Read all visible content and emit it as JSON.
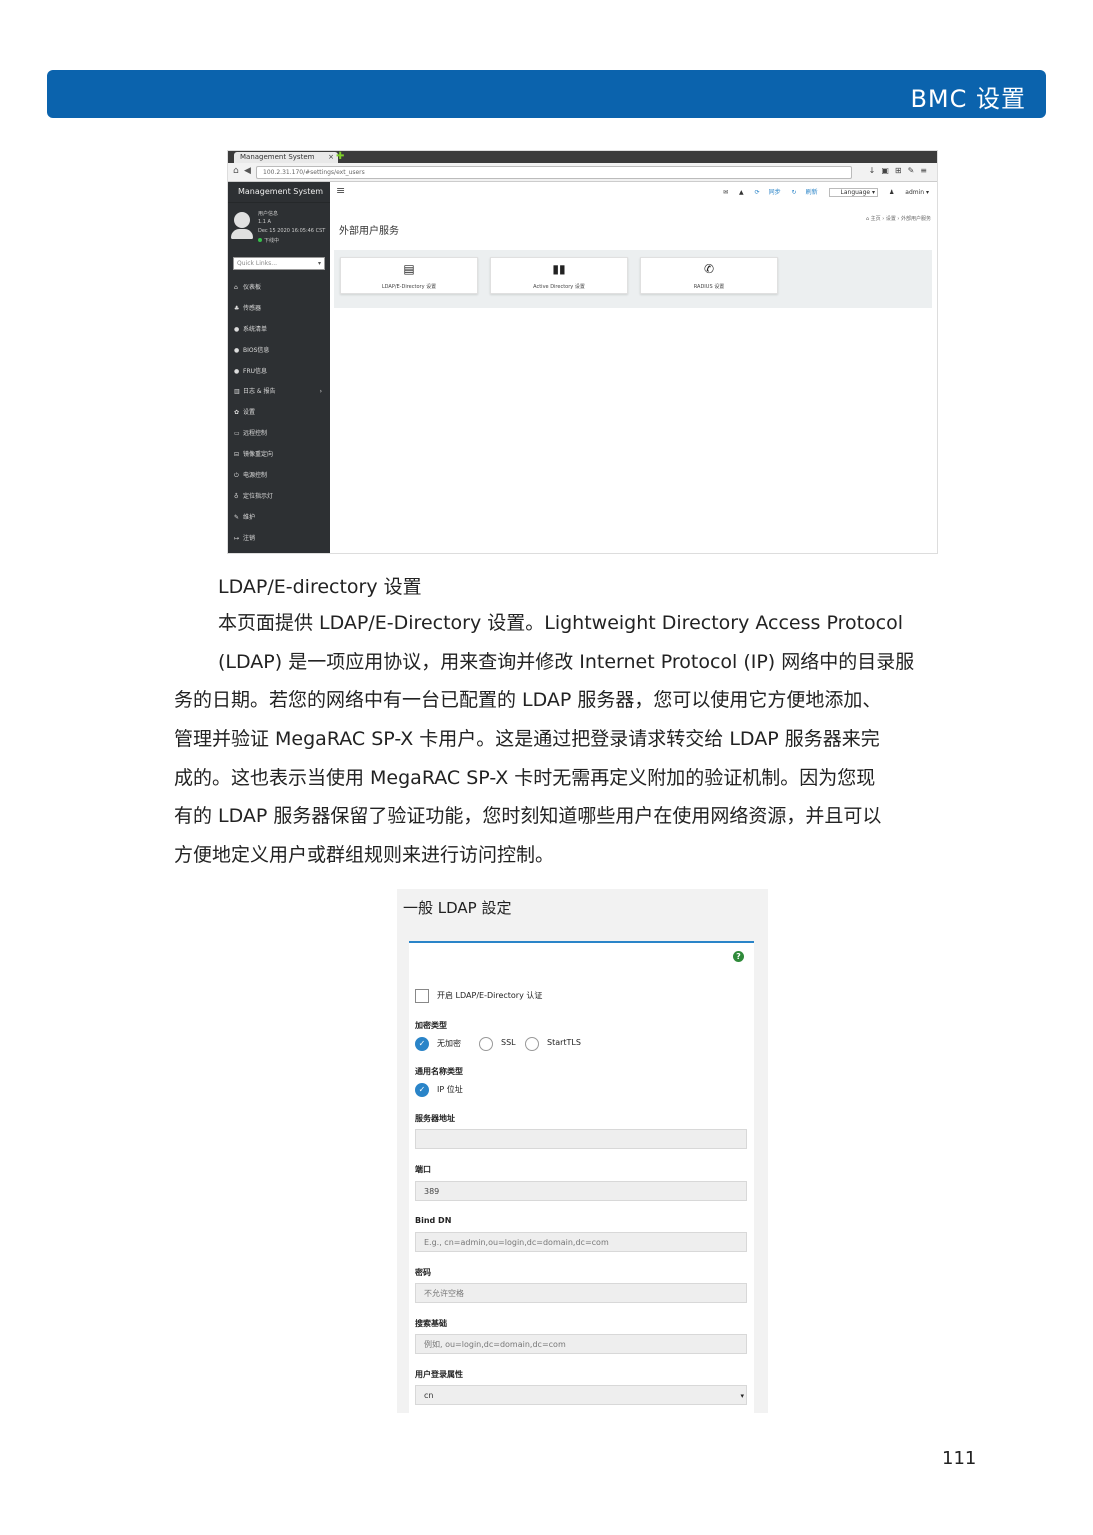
{
  "header": {
    "title": "BMC 设置"
  },
  "shot1": {
    "browser_tab": "Management System",
    "tab_close": "×",
    "url": "100.2.31.170/#settings/ext_users",
    "sidebar": {
      "brand": "Management System",
      "user_lines": [
        "用户信息",
        "1.1 A",
        "Dec 15 2020 16:05:46 CST",
        "下线中"
      ],
      "quick_links": "Quick Links...",
      "items": [
        {
          "icon": "⌂",
          "label": "仪表板"
        },
        {
          "icon": "♣",
          "label": "传感器"
        },
        {
          "icon": "●",
          "label": "系统清单"
        },
        {
          "icon": "●",
          "label": "BIOS信息"
        },
        {
          "icon": "●",
          "label": "FRU信息"
        },
        {
          "icon": "▥",
          "label": "日志 & 报告",
          "arrow": "›"
        },
        {
          "icon": "✿",
          "label": "设置"
        },
        {
          "icon": "▭",
          "label": "远程控制"
        },
        {
          "icon": "⊟",
          "label": "镜像重定向"
        },
        {
          "icon": "⏻",
          "label": "电源控制"
        },
        {
          "icon": "♁",
          "label": "定位指示灯"
        },
        {
          "icon": "✎",
          "label": "维护"
        },
        {
          "icon": "↦",
          "label": "注销"
        }
      ]
    },
    "topnav": {
      "sync": "同步",
      "refresh": "刷新",
      "language": "Language",
      "user": "admin"
    },
    "page_title": "外部用户服务",
    "breadcrumb": "⌂ 主页 › 设置 › 外部用户服务",
    "cards": [
      {
        "icon": "▤",
        "label": "LDAP/E-Directory 设置"
      },
      {
        "icon": "▮▮",
        "label": "Active Directory 设置"
      },
      {
        "icon": "✆",
        "label": "RADIUS 设置"
      }
    ]
  },
  "caption": "LDAP/E-directory 设置",
  "paragraph": [
    "本页面提供 LDAP/E-Directory 设置。Lightweight Directory Access Protocol",
    "(LDAP) 是一项应用协议，用来查询并修改 Internet Protocol (IP) 网络中的目录服",
    "务的日期。若您的网络中有一台已配置的 LDAP 服务器，您可以使用它方便地添加、",
    "管理并验证 MegaRAC SP-X 卡用户。这是通过把登录请求转交给 LDAP 服务器来完",
    "成的。这也表示当使用 MegaRAC SP-X 卡时无需再定义附加的验证机制。因为您现",
    "有的 LDAP 服务器保留了验证功能，您时刻知道哪些用户在使用网络资源，并且可以",
    "方便地定义用户或群组规则来进行访问控制。"
  ],
  "shot2": {
    "title": "一般 LDAP 設定",
    "enable_label": "开启 LDAP/E-Directory 认证",
    "encryption_label": "加密类型",
    "encryption_options": [
      "无加密",
      "SSL",
      "StartTLS"
    ],
    "common_name_label": "通用名称类型",
    "common_name_option": "IP 位址",
    "server_address_label": "服务器地址",
    "server_address_value": "",
    "port_label": "端口",
    "port_value": "389",
    "bind_dn_label": "Bind DN",
    "bind_dn_placeholder": "E.g., cn=admin,ou=login,dc=domain,dc=com",
    "password_label": "密码",
    "password_placeholder": "不允许空格",
    "search_base_label": "搜索基础",
    "search_base_placeholder": "例如, ou=login,dc=domain,dc=com",
    "login_attr_label": "用户登录属性",
    "login_attr_value": "cn"
  },
  "page_number": "111"
}
